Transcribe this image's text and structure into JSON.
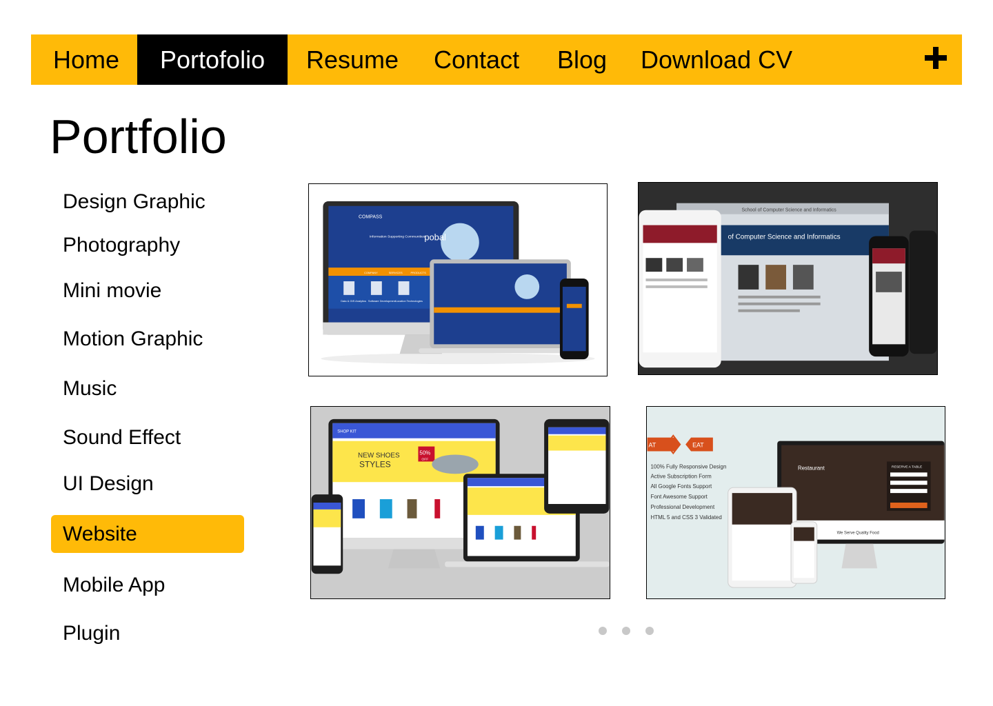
{
  "nav": {
    "items": [
      "Home",
      "Portofolio",
      "Resume",
      "Contact",
      "Blog",
      "Download CV"
    ],
    "active": "Portofolio",
    "plus_icon": "plus-icon"
  },
  "page": {
    "title": "Portfolio"
  },
  "categories": {
    "items": [
      "Design Graphic",
      "Photography",
      "Mini movie",
      "Motion Graphic",
      "Music",
      "Sound Effect",
      "UI Design",
      "Website",
      "Mobile App",
      "Plugin"
    ],
    "active": "Website"
  },
  "gallery": {
    "items": [
      {
        "name": "compass-pobal-responsive",
        "brand": "COMPASS",
        "logo": "pobal",
        "hero_text": "Information Supporting Communities",
        "menu": [
          "COMPANY",
          "SERVICES",
          "PRODUCTS"
        ],
        "features": [
          "Data & GIS Analytics",
          "Software Development",
          "Location Technologies"
        ]
      },
      {
        "name": "computer-science-school-responsive",
        "header_text": "of Computer Science and Informatics",
        "browser_title": "School of Computer Science and Informatics"
      },
      {
        "name": "shop-new-shoes-responsive",
        "brand": "SHOP KIT",
        "promo_line1": "NEW SHOES",
        "promo_line2": "STYLES",
        "discount": "50%",
        "discount_sub": "OFF"
      },
      {
        "name": "restaurant-eat-responsive",
        "logo_left": "AT",
        "logo_mid": "&",
        "logo_right": "EAT",
        "features": [
          "100% Fully Responsive Design",
          "Active Subscription Form",
          "All Google Fonts Support",
          "Font Awesome Support",
          "Professional Development",
          "HTML 5 and CSS 3 Validated"
        ],
        "screen_title": "Restaurant",
        "form_title": "RESERVE A TABLE",
        "tagline": "We Serve Quality Food"
      }
    ]
  },
  "pagination": {
    "count": 3
  },
  "colors": {
    "accent": "#ffba08",
    "active_nav_bg": "#000000",
    "dot": "#c8c8c8"
  }
}
